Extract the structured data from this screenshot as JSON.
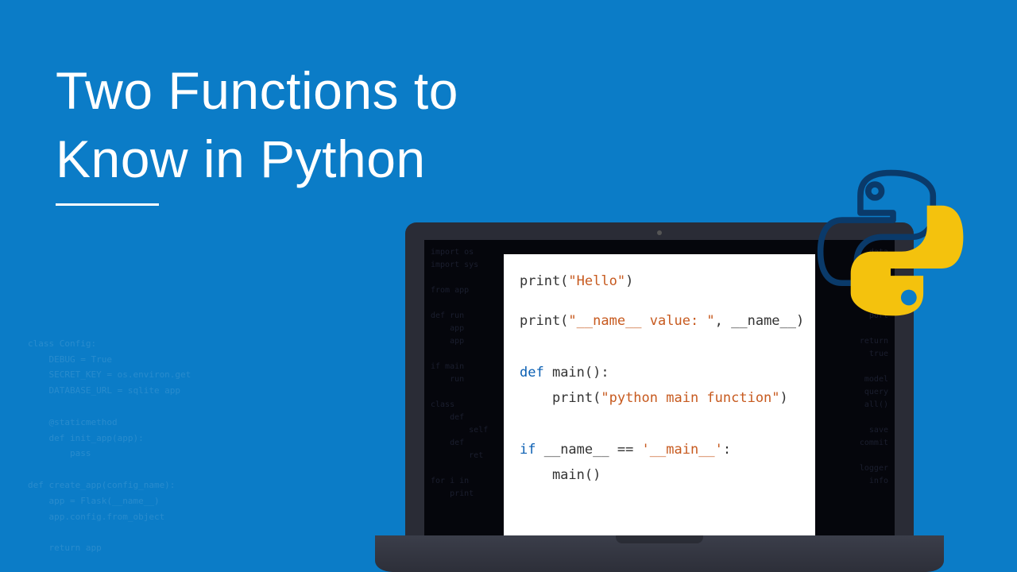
{
  "title": {
    "line1": "Two Functions to",
    "line2": "Know in Python"
  },
  "code": {
    "l1_a": "print(",
    "l1_b": "\"Hello\"",
    "l1_c": ")",
    "l2_a": "print(",
    "l2_b": "\"__name__ value: \"",
    "l2_c": ", __name__)",
    "l3_a": "def",
    "l3_b": " main():",
    "l4_a": "    print(",
    "l4_b": "\"python main function\"",
    "l4_c": ")",
    "l5_a": "if",
    "l5_b": " __name__ == ",
    "l5_c": "'__main__'",
    "l5_d": ":",
    "l6": "    main()"
  },
  "bg_left": "class Config:\n    DEBUG = True\n    SECRET_KEY = os.environ.get\n    DATABASE_URL = sqlite app\n\n    @staticmethod\n    def init_app(app):\n        pass\n\ndef create_app(config_name):\n    app = Flask(__name__)\n    app.config.from_object\n\n    return app",
  "screen_bg_l": "import os\nimport sys\n\nfrom app\n\ndef run\n    app\n    app\n\nif main\n    run\n\nclass\n    def\n        self\n    def\n        ret\n\nfor i in\n    print",
  "screen_bg_r": "data\nconfig\n\napp.run\nhost\nport\n\nreturn\ntrue\n\nmodel\nquery\nall()\n\nsave\ncommit\n\nlogger\ninfo"
}
